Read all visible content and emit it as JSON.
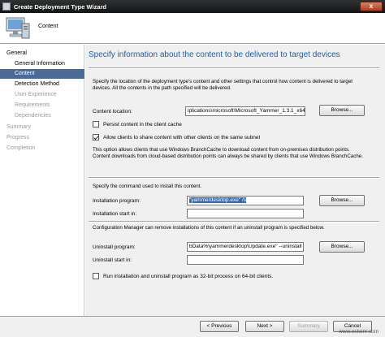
{
  "window": {
    "title": "Create Deployment Type Wizard",
    "close_glyph": "x"
  },
  "header": {
    "title": "Content"
  },
  "nav": [
    {
      "label": "General",
      "indent": 0,
      "state": "normal"
    },
    {
      "label": "General Information",
      "indent": 1,
      "state": "normal"
    },
    {
      "label": "Content",
      "indent": 1,
      "state": "selected"
    },
    {
      "label": "Detection Method",
      "indent": 1,
      "state": "normal"
    },
    {
      "label": "User Experience",
      "indent": 1,
      "state": "grey"
    },
    {
      "label": "Requirements",
      "indent": 1,
      "state": "grey"
    },
    {
      "label": "Dependencies",
      "indent": 1,
      "state": "grey"
    },
    {
      "label": "Summary",
      "indent": 0,
      "state": "grey"
    },
    {
      "label": "Progress",
      "indent": 0,
      "state": "grey"
    },
    {
      "label": "Completion",
      "indent": 0,
      "state": "grey"
    }
  ],
  "main": {
    "title": "Specify information about the content to be delivered to target devices",
    "intro": "Specify the location of the deployment type's content and other settings that control how content is delivered to target devices. All the contents in the path specified will be delivered.",
    "content_location_label": "Content location:",
    "content_location_value": "iplications\\microsoft\\Microsoft_Yammer_1.3.1_x64",
    "browse_label": "Browse...",
    "persist_label": "Persist content in the client cache",
    "persist_checked": false,
    "allow_share_label": "Allow clients to share content with other clients on the same subnet",
    "allow_share_checked": true,
    "branchcache_text": "This option allows clients that use Windows BranchCache to download content from on-premises distribution points. Content downloads from cloud-based distribution points can always be shared by clients that use Windows BranchCache.",
    "install_cmd_text": "Specify the command used to install this content.",
    "install_program_label": "Installation program:",
    "install_program_value": "\"yammerdesktop.exe\" /s",
    "install_start_label": "Installation start in:",
    "install_start_value": "",
    "uninstall_text": "Configuration Manager can remove installations of this content if an uninstall program is specified below.",
    "uninstall_program_label": "Uninstall program:",
    "uninstall_program_value": "bData%\\yammerdesktop\\Update.exe\" --uninstall -s",
    "uninstall_start_label": "Uninstall start in:",
    "uninstall_start_value": "",
    "x86_label": "Run installation and uninstall program as 32-bit process on 64-bit clients.",
    "x86_checked": false
  },
  "footer": {
    "previous": "< Previous",
    "next": "Next >",
    "summary": "Summary",
    "cancel": "Cancel",
    "watermark": "www.eskonr.com"
  },
  "icons": {
    "header_icon": "computer-icon",
    "title_icon": "wizard-icon"
  }
}
